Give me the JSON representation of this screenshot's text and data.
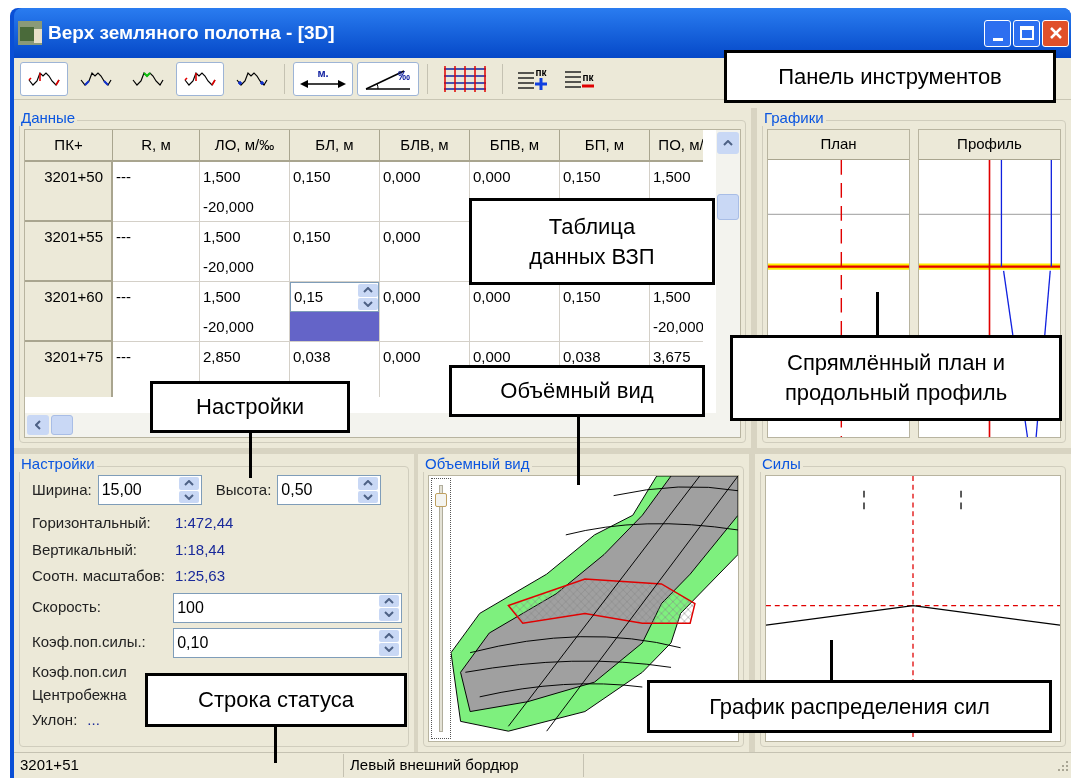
{
  "window": {
    "title": "Верх земляного полотна - [3D]"
  },
  "toolbar": [
    {
      "kind": "ends",
      "pressed": true
    },
    {
      "kind": "slopes",
      "pressed": false
    },
    {
      "kind": "top",
      "pressed": false
    },
    {
      "kind": "ends",
      "pressed": true
    },
    {
      "kind": "marks",
      "pressed": false
    },
    {
      "kind": "separator"
    },
    {
      "kind": "distance",
      "label": "м.",
      "pressed": true
    },
    {
      "kind": "slope",
      "label": "‰",
      "pressed": true
    },
    {
      "kind": "separator"
    },
    {
      "kind": "grid",
      "pressed": false
    },
    {
      "kind": "separator"
    },
    {
      "kind": "add-pk",
      "label": "пк",
      "pressed": false
    },
    {
      "kind": "remove-pk",
      "label": "пк",
      "pressed": false
    }
  ],
  "data_panel": {
    "title": "Данные",
    "columns": [
      "ПК+",
      "R, м",
      "ЛО, м/‰",
      "БЛ, м",
      "БЛВ, м",
      "БПВ, м",
      "БП, м",
      "ПО, м/"
    ],
    "rows": [
      {
        "cells": [
          {
            "kind": "pk",
            "lines": [
              "3201+50"
            ]
          },
          {
            "kind": "text",
            "lines": [
              "---"
            ]
          },
          {
            "kind": "text",
            "lines": [
              "1,500",
              "-20,000"
            ]
          },
          {
            "kind": "text",
            "lines": [
              "0,150"
            ]
          },
          {
            "kind": "text",
            "lines": [
              "0,000"
            ]
          },
          {
            "kind": "text",
            "lines": [
              "0,000"
            ]
          },
          {
            "kind": "text",
            "lines": [
              "0,150"
            ]
          },
          {
            "kind": "text",
            "lines": [
              "1,500"
            ]
          }
        ]
      },
      {
        "cells": [
          {
            "kind": "pk",
            "lines": [
              "3201+55"
            ]
          },
          {
            "kind": "text",
            "lines": [
              "---"
            ]
          },
          {
            "kind": "text",
            "lines": [
              "1,500",
              "-20,000"
            ]
          },
          {
            "kind": "text",
            "lines": [
              "0,150"
            ]
          },
          {
            "kind": "text",
            "lines": [
              "0,000"
            ]
          }
        ]
      },
      {
        "cells": [
          {
            "kind": "pk",
            "lines": [
              "3201+60"
            ]
          },
          {
            "kind": "text",
            "lines": [
              "---"
            ]
          },
          {
            "kind": "text",
            "lines": [
              "1,500",
              "-20,000"
            ]
          },
          {
            "kind": "spin",
            "lines": [
              "0,15"
            ]
          },
          {
            "kind": "text",
            "lines": [
              "0,000"
            ]
          },
          {
            "kind": "text",
            "lines": [
              "0,000"
            ]
          },
          {
            "kind": "text",
            "lines": [
              "0,150"
            ]
          },
          {
            "kind": "text",
            "lines": [
              "1,500",
              "-20,000"
            ]
          }
        ]
      },
      {
        "cells": [
          {
            "kind": "pk",
            "lines": [
              "3201+75"
            ]
          },
          {
            "kind": "text",
            "lines": [
              "---"
            ]
          },
          {
            "kind": "text",
            "lines": [
              "2,850"
            ]
          },
          {
            "kind": "text",
            "lines": [
              "0,038"
            ]
          },
          {
            "kind": "text",
            "lines": [
              "0,000"
            ]
          },
          {
            "kind": "text",
            "lines": [
              "0,000"
            ]
          },
          {
            "kind": "text",
            "lines": [
              "0,038"
            ]
          },
          {
            "kind": "text",
            "lines": [
              "3,675"
            ]
          }
        ]
      }
    ]
  },
  "graphs_panel": {
    "title": "Графики",
    "columns": [
      "План",
      "Профиль"
    ]
  },
  "settings_panel": {
    "title": "Настройки",
    "width": {
      "label": "Ширина:",
      "value": "15,00"
    },
    "height": {
      "label": "Высота:",
      "value": "0,50"
    },
    "scales": [
      {
        "label": "Горизонтальный:",
        "value": "1:472,44"
      },
      {
        "label": "Вертикальный:",
        "value": "1:18,44"
      },
      {
        "label": "Соотн. масштабов:",
        "value": "1:25,63"
      }
    ],
    "speed": {
      "label": "Скорость:",
      "value": "100"
    },
    "coef": {
      "label": "Коэф.поп.силы.:",
      "value": "0,10"
    },
    "partial_lines": [
      "Коэф.поп.сил",
      "Центробежна"
    ],
    "slope": {
      "label": "Уклон:",
      "value": "..."
    }
  },
  "view3d": {
    "title": "Объемный вид",
    "zoom": {
      "level": 0.96
    }
  },
  "forces": {
    "title": "Силы"
  },
  "status_bar": [
    "3201+51",
    "Левый внешний бордюр"
  ],
  "callouts": [
    "Панель инструментов",
    "Таблица данных ВЗП",
    "Настройки",
    "Объёмный вид",
    "Спрямлённый план и продольный профиль",
    "Строка статуса",
    "График распределения сил"
  ]
}
